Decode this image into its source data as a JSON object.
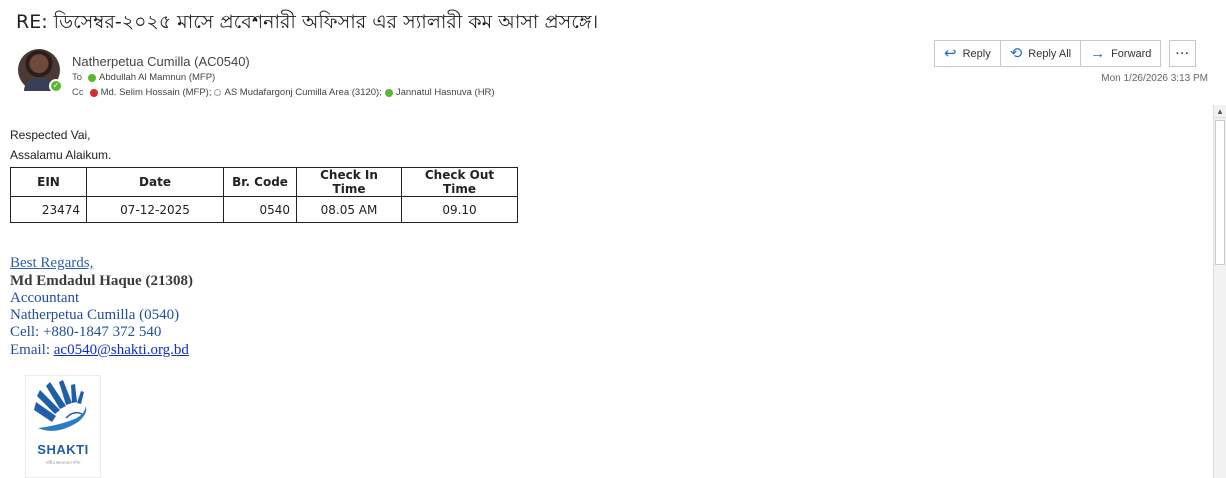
{
  "email": {
    "subject": "RE: ডিসেম্বর-২০২৫ মাসে প্রবেশনারী অফিসার এর স্যালারী কম আসা প্রসঙ্গে।",
    "sender": "Natherpetua Cumilla (AC0540)",
    "to_label": "To",
    "to": [
      {
        "name": "Abdullah Al Mamnun (MFP)",
        "status": "available"
      }
    ],
    "cc_label": "Cc",
    "cc": [
      {
        "name": "Md. Selim Hossain (MFP);",
        "status": "busy"
      },
      {
        "name": "AS Mudafargonj Cumilla Area (3120);",
        "status": "offline"
      },
      {
        "name": "Jannatul Hasnuva (HR)",
        "status": "available"
      }
    ],
    "date": "Mon 1/26/2026 3:13 PM"
  },
  "actions": {
    "reply": "Reply",
    "reply_all": "Reply All",
    "forward": "Forward",
    "more": "···"
  },
  "body": {
    "greeting": "Respected  Vai,",
    "salam": "Assalamu  Alaikum.",
    "table": {
      "headers": [
        "EIN",
        "Date",
        "Br. Code",
        "Check In Time",
        "Check Out Time"
      ],
      "rows": [
        [
          "23474",
          "07-12-2025",
          "0540",
          "08.05 AM",
          "09.10"
        ]
      ]
    }
  },
  "signature": {
    "regards": "Best Regards,",
    "name": "Md Emdadul Haque (21308)",
    "role": "Accountant",
    "office": "Natherpetua Cumilla (0540)",
    "cell": "Cell: +880-1847 372 540",
    "email_label": "Email: ",
    "email": "ac0540@shakti.org.bd",
    "logo_word": "SHAKTI",
    "logo_tagline": "নারীর ক্ষমতায়নে শক্তি"
  },
  "icons": {
    "reply": "reply-icon",
    "reply_all": "reply-all-icon",
    "forward": "forward-icon",
    "more": "more-icon"
  },
  "colors": {
    "link": "#0b2fc9",
    "signature": "#1f4e9e",
    "accent": "#2b6cc4",
    "available": "#5bb630",
    "busy": "#d92b2b"
  }
}
